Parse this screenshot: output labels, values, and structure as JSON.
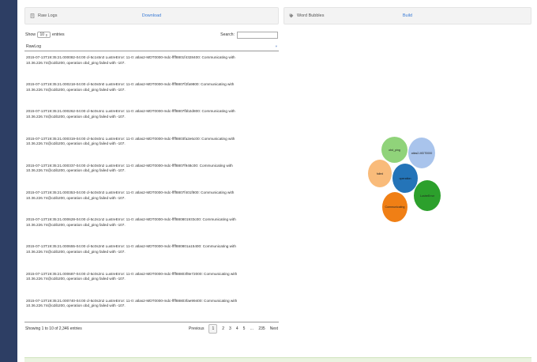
{
  "raw_logs_panel": {
    "title": "Raw Logs",
    "action": "Download",
    "show_label": "Show",
    "page_length": "10",
    "entries_label": "entries",
    "search_label": "Search:",
    "search_value": "",
    "column_header": "RawLog",
    "rows": [
      {
        "line1": "2015-07-13T19:35:21.000082-04:00 cl-5c1s5n3 LustreError: 11-0: atlas2-MDT0000-mdc-ffff8801f4328400: Communicating with",
        "line2": "10.36.226.74@o2ib200, operation obd_ping failed with -107."
      },
      {
        "line1": "2015-07-13T19:35:21.000218-04:00 cl-5c0s0n0 LustreError: 11-0: atlas2-MDT0000-mdc-ffff8807f2fa9800: Communicating with",
        "line2": "10.36.226.74@o2ib200, operation obd_ping failed with -107."
      },
      {
        "line1": "2015-07-13T19:35:21.000262-04:00 cl-5c0s4n1 LustreError: 11-0: atlas2-MDT0000-mdc-ffff8807fbb2d800: Communicating with",
        "line2": "10.36.226.74@o2ib200, operation obd_ping failed with -107."
      },
      {
        "line1": "2015-07-13T19:35:21.000319-04:00 cl-5c0s0n1 LustreError: 11-0: atlas2-MDT0000-mdc-ffff8803fa2e6c00: Communicating with",
        "line2": "10.36.226.74@o2ib200, operation obd_ping failed with -107."
      },
      {
        "line1": "2015-07-13T19:35:21.000337-04:00 cl-5c0s0n2 LustreError: 11-0: atlas2-MDT0000-mdc-ffff8807f948c00: Communicating with",
        "line2": "10.36.226.74@o2ib200, operation obd_ping failed with -107."
      },
      {
        "line1": "2015-07-13T19:35:21.000353-04:00 cl-5c0s0n3 LustreError: 11-0: atlas2-MDT0000-mdc-ffff8807f401f800: Communicating with",
        "line2": "10.36.226.74@o2ib200, operation obd_ping failed with -107."
      },
      {
        "line1": "2015-07-13T19:35:21.000628-04:00 cl-5c2s1n2 LustreError: 11-0: atlas2-MDT0000-mdc-ffff880801933c00: Communicating with",
        "line2": "10.36.226.74@o2ib200, operation obd_ping failed with -107."
      },
      {
        "line1": "2015-07-13T19:35:21.000655-04:00 cl-5c0s2n0 LustreError: 11-0: atlas2-MDT0000-mdc-ffff880801a15400: Communicating with",
        "line2": "10.36.226.74@o2ib200, operation obd_ping failed with -107."
      },
      {
        "line1": "2015-07-13T19:35:21.000687-04:00 cl-5c0s2n1 LustreError: 11-0: atlas2-MDT0000-mdc-ffff88803f8e72000: Communicating with",
        "line2": "10.36.226.74@o2ib200, operation obd_ping failed with -107."
      },
      {
        "line1": "2015-07-13T19:35:21.000740-04:00 cl-5c0s2n2 LustreError: 11-0: atlas2-MDT0000-mdc-ffff88803fae99400: Communicating with",
        "line2": "10.36.226.74@o2ib200, operation obd_ping failed with -107."
      }
    ],
    "info": "Showing 1 to 10 of 2,346 entries",
    "pager": {
      "previous": "Previous",
      "pages": [
        "1",
        "2",
        "3",
        "4",
        "5",
        "…",
        "235"
      ],
      "current": "1",
      "next": "Next"
    }
  },
  "word_bubbles_panel": {
    "title": "Word Bubbles",
    "action": "Build",
    "bubbles": [
      {
        "word": "obd_ping",
        "color": "#90d37a"
      },
      {
        "word": "atlas2-MDT0000",
        "color": "#a9c4ec"
      },
      {
        "word": "failed",
        "color": "#f9bb7a"
      },
      {
        "word": "operation",
        "color": "#2474b8"
      },
      {
        "word": "LustreError",
        "color": "#2ca02c"
      },
      {
        "word": "Communicating",
        "color": "#f07f15"
      }
    ]
  },
  "colors": {
    "sidebar": "#2d3e64",
    "link": "#3a7bd5"
  }
}
